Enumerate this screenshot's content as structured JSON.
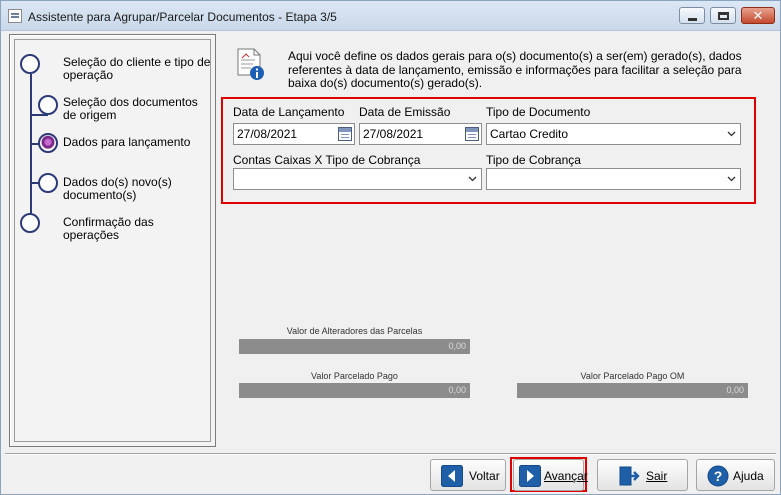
{
  "window": {
    "title": "Assistente para Agrupar/Parcelar Documentos - Etapa 3/5",
    "close_label": "✕"
  },
  "steps": [
    {
      "label": "Seleção do cliente e tipo de operação",
      "active": false
    },
    {
      "label": "Seleção dos documentos de origem",
      "active": false
    },
    {
      "label": "Dados para lançamento",
      "active": true
    },
    {
      "label": "Dados do(s) novo(s) documento(s)",
      "active": false
    },
    {
      "label": "Confirmação das operações",
      "active": false
    }
  ],
  "description": "Aqui você define os dados gerais para o(s) documento(s) a ser(em) gerado(s), dados referentes à data de lançamento, emissão e informações para facilitar a seleção para baixa do(s) documento(s) gerado(s).",
  "form": {
    "data_lancamento_label": "Data de Lançamento",
    "data_lancamento_value": "27/08/2021",
    "data_emissao_label": "Data de Emissão",
    "data_emissao_value": "27/08/2021",
    "tipo_documento_label": "Tipo de Documento",
    "tipo_documento_value": "Cartao Credito",
    "contas_caixas_label": "Contas Caixas X Tipo de Cobrança",
    "contas_caixas_value": "",
    "tipo_cobranca_label": "Tipo de Cobrança",
    "tipo_cobranca_value": ""
  },
  "values": {
    "alteradores_label": "Valor de Alteradores das Parcelas",
    "alteradores_value": "0,00",
    "parcelado_pago_label": "Valor Parcelado Pago",
    "parcelado_pago_value": "0,00",
    "parcelado_pago_om_label": "Valor Parcelado Pago OM",
    "parcelado_pago_om_value": "0,00"
  },
  "buttons": {
    "voltar": "Voltar",
    "avancar": "Avançar",
    "sair": "Sair",
    "ajuda": "Ajuda"
  },
  "colors": {
    "highlight": "#e00000",
    "step_line": "#2d3a78",
    "button_icon": "#1f5fa8"
  }
}
